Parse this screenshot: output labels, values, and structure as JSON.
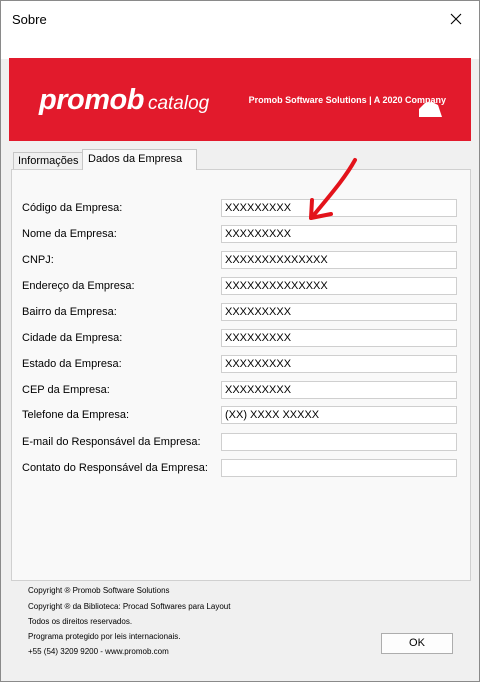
{
  "window": {
    "title": "Sobre"
  },
  "banner": {
    "brand": "promob",
    "product": "catalog",
    "company": "Promob Software Solutions | A 2020 Company",
    "color": "#e21a2c"
  },
  "tabs": [
    {
      "label": "Informações",
      "active": false
    },
    {
      "label": "Dados da Empresa",
      "active": true
    }
  ],
  "fields": [
    {
      "label": "Código da Empresa:",
      "value": "XXXXXXXXX"
    },
    {
      "label": "Nome da Empresa:",
      "value": "XXXXXXXXX"
    },
    {
      "label": "CNPJ:",
      "value": "XXXXXXXXXXXXXX"
    },
    {
      "label": "Endereço da Empresa:",
      "value": "XXXXXXXXXXXXXX"
    },
    {
      "label": "Bairro da Empresa:",
      "value": "XXXXXXXXX"
    },
    {
      "label": "Cidade da Empresa:",
      "value": "XXXXXXXXX"
    },
    {
      "label": "Estado da Empresa:",
      "value": "XXXXXXXXX"
    },
    {
      "label": "CEP da Empresa:",
      "value": "XXXXXXXXX"
    },
    {
      "label": "Telefone da Empresa:",
      "value": "(XX) XXXX XXXXX"
    },
    {
      "label": "E-mail do Responsável da Empresa:",
      "value": ""
    },
    {
      "label": "Contato do Responsável da Empresa:",
      "value": ""
    }
  ],
  "footer": [
    "Copyright ® Promob Software Solutions",
    "Copyright ® da Biblioteca: Procad Softwares para Layout",
    "Todos os direitos reservados.",
    "Programa protegido por leis internacionais.",
    "+55 (54) 3209 9200  -  www.promob.com"
  ],
  "ok_label": "OK",
  "annotation": {
    "icon": "red-arrow-icon",
    "color": "#e3131b"
  }
}
